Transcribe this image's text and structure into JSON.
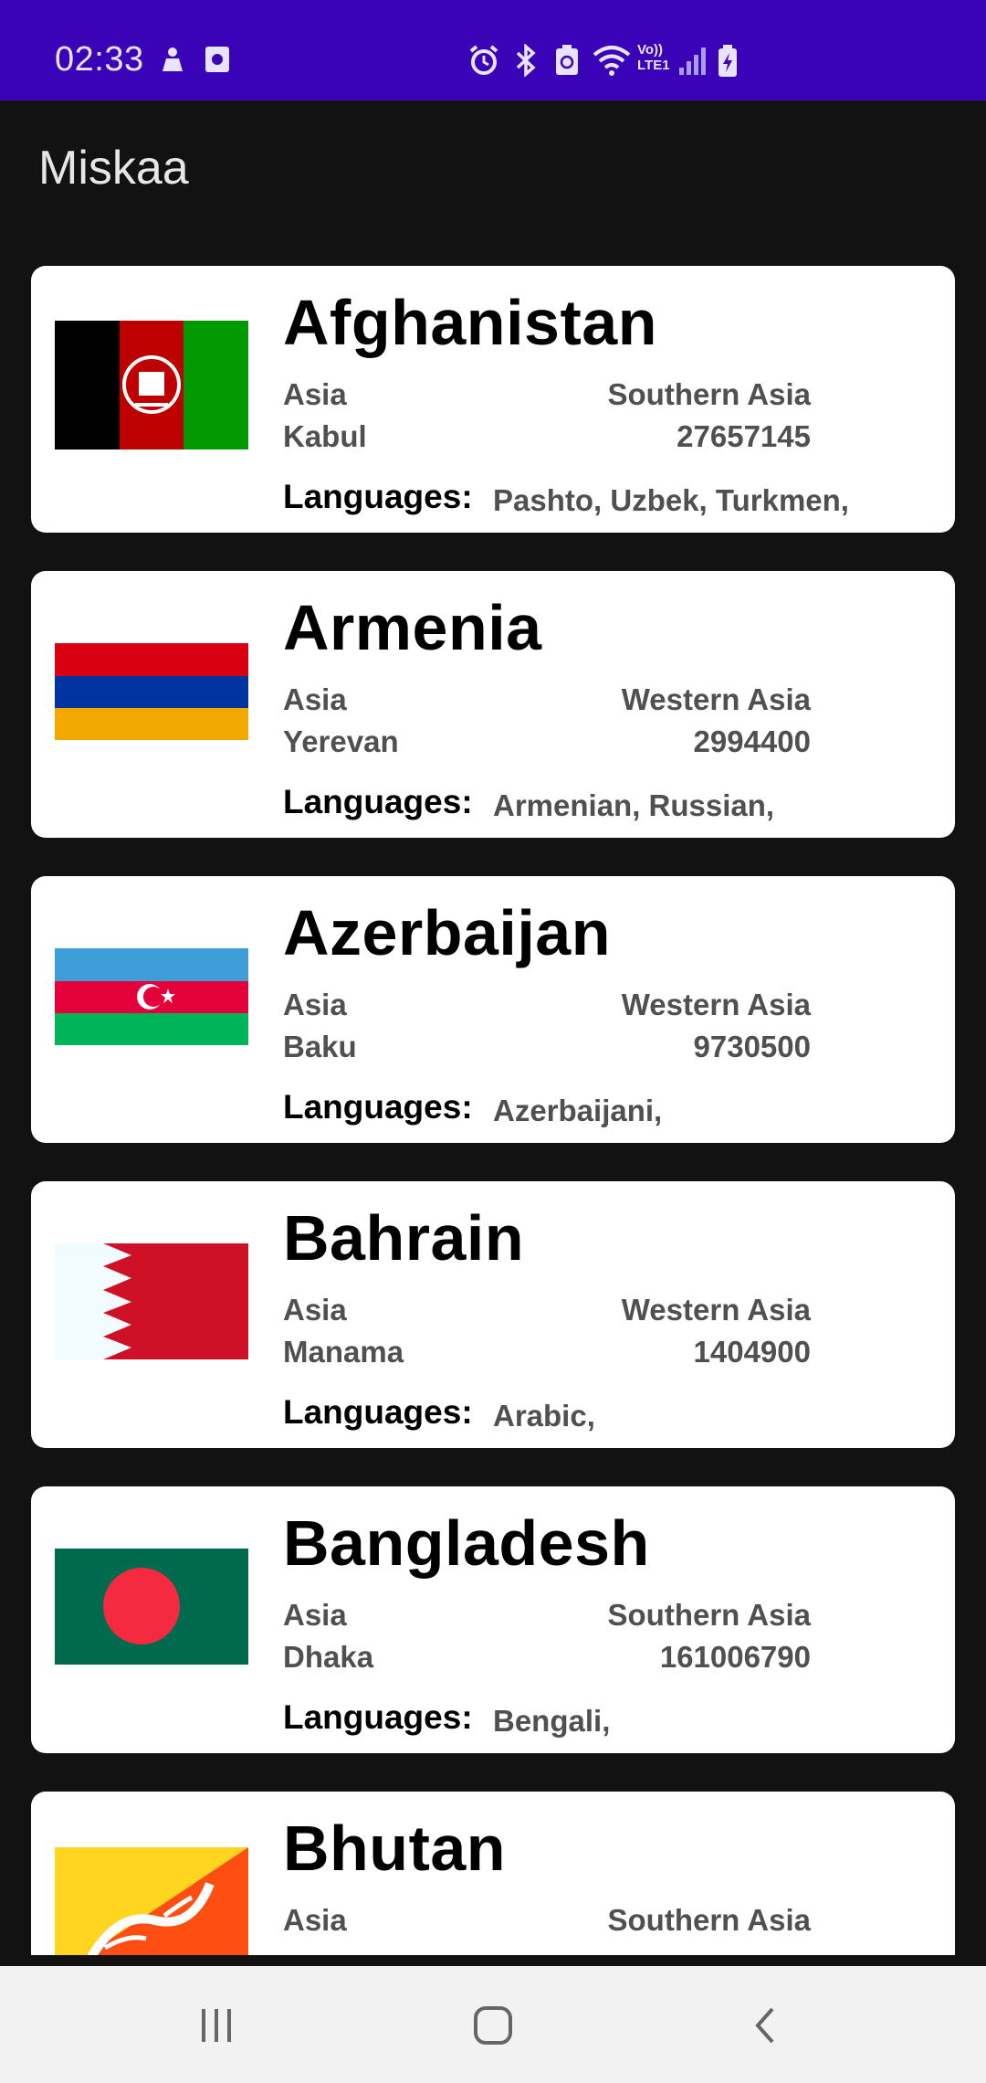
{
  "status_bar": {
    "time": "02:33",
    "left_icons": [
      "notification-icon",
      "screen-recorder-icon"
    ],
    "right_icons": [
      "alarm-icon",
      "bluetooth-icon",
      "battery-saver-icon",
      "wifi-icon",
      "volte-lte-icon",
      "signal-icon",
      "battery-charging-icon"
    ],
    "network_label_top": "Vo))",
    "network_label_bottom": "LTE1",
    "background": "#3a03b8"
  },
  "app_bar": {
    "title": "Miskaa"
  },
  "countries_label": "Languages:",
  "countries": [
    {
      "name": "Afghanistan",
      "region": "Asia",
      "subregion": "Southern Asia",
      "capital": "Kabul",
      "population": "27657145",
      "languages": "Pashto, Uzbek, Turkmen,",
      "flag": "afghanistan-flag-icon"
    },
    {
      "name": "Armenia",
      "region": "Asia",
      "subregion": "Western Asia",
      "capital": "Yerevan",
      "population": "2994400",
      "languages": "Armenian, Russian,",
      "flag": "armenia-flag-icon"
    },
    {
      "name": "Azerbaijan",
      "region": "Asia",
      "subregion": "Western Asia",
      "capital": "Baku",
      "population": "9730500",
      "languages": "Azerbaijani,",
      "flag": "azerbaijan-flag-icon"
    },
    {
      "name": "Bahrain",
      "region": "Asia",
      "subregion": "Western Asia",
      "capital": "Manama",
      "population": "1404900",
      "languages": "Arabic,",
      "flag": "bahrain-flag-icon"
    },
    {
      "name": "Bangladesh",
      "region": "Asia",
      "subregion": "Southern Asia",
      "capital": "Dhaka",
      "population": "161006790",
      "languages": "Bengali,",
      "flag": "bangladesh-flag-icon"
    },
    {
      "name": "Bhutan",
      "region": "Asia",
      "subregion": "Southern Asia",
      "capital": "",
      "population": "",
      "languages": "",
      "flag": "bhutan-flag-icon"
    }
  ],
  "nav_bar": {
    "buttons": [
      "recent-apps-icon",
      "home-icon",
      "back-icon"
    ]
  },
  "colors": {
    "status_bar": "#3a03b8",
    "app_background": "#121212",
    "card": "#ffffff",
    "secondary_text": "#505050"
  }
}
